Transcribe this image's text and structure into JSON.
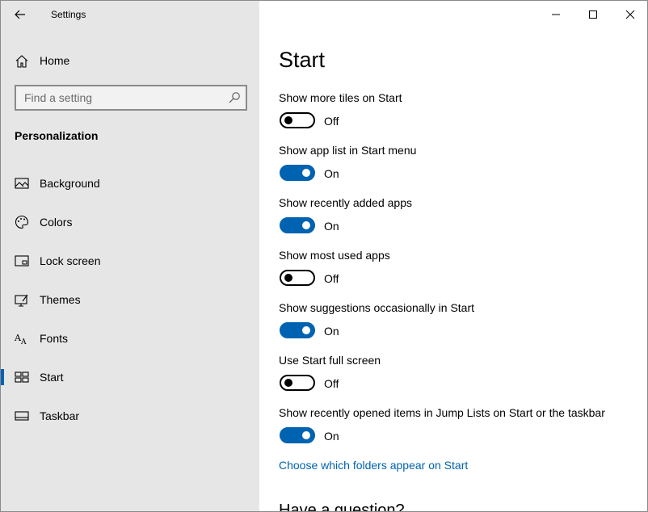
{
  "window": {
    "title": "Settings"
  },
  "sidebar": {
    "home_label": "Home",
    "search": {
      "placeholder": "Find a setting",
      "value": ""
    },
    "section_title": "Personalization",
    "items": [
      {
        "label": "Background",
        "icon": "picture-icon",
        "selected": false
      },
      {
        "label": "Colors",
        "icon": "palette-icon",
        "selected": false
      },
      {
        "label": "Lock screen",
        "icon": "lock-screen-icon",
        "selected": false
      },
      {
        "label": "Themes",
        "icon": "themes-icon",
        "selected": false
      },
      {
        "label": "Fonts",
        "icon": "fonts-icon",
        "selected": false
      },
      {
        "label": "Start",
        "icon": "start-tiles-icon",
        "selected": true
      },
      {
        "label": "Taskbar",
        "icon": "taskbar-icon",
        "selected": false
      }
    ]
  },
  "main": {
    "title": "Start",
    "settings": [
      {
        "label": "Show more tiles on Start",
        "on": false,
        "state": "Off"
      },
      {
        "label": "Show app list in Start menu",
        "on": true,
        "state": "On"
      },
      {
        "label": "Show recently added apps",
        "on": true,
        "state": "On"
      },
      {
        "label": "Show most used apps",
        "on": false,
        "state": "Off"
      },
      {
        "label": "Show suggestions occasionally in Start",
        "on": true,
        "state": "On"
      },
      {
        "label": "Use Start full screen",
        "on": false,
        "state": "Off"
      },
      {
        "label": "Show recently opened items in Jump Lists on Start or the taskbar",
        "on": true,
        "state": "On"
      }
    ],
    "link": "Choose which folders appear on Start",
    "question_heading": "Have a question?"
  },
  "colors": {
    "accent": "#0063b1",
    "sidebar_bg": "#e6e6e6"
  }
}
